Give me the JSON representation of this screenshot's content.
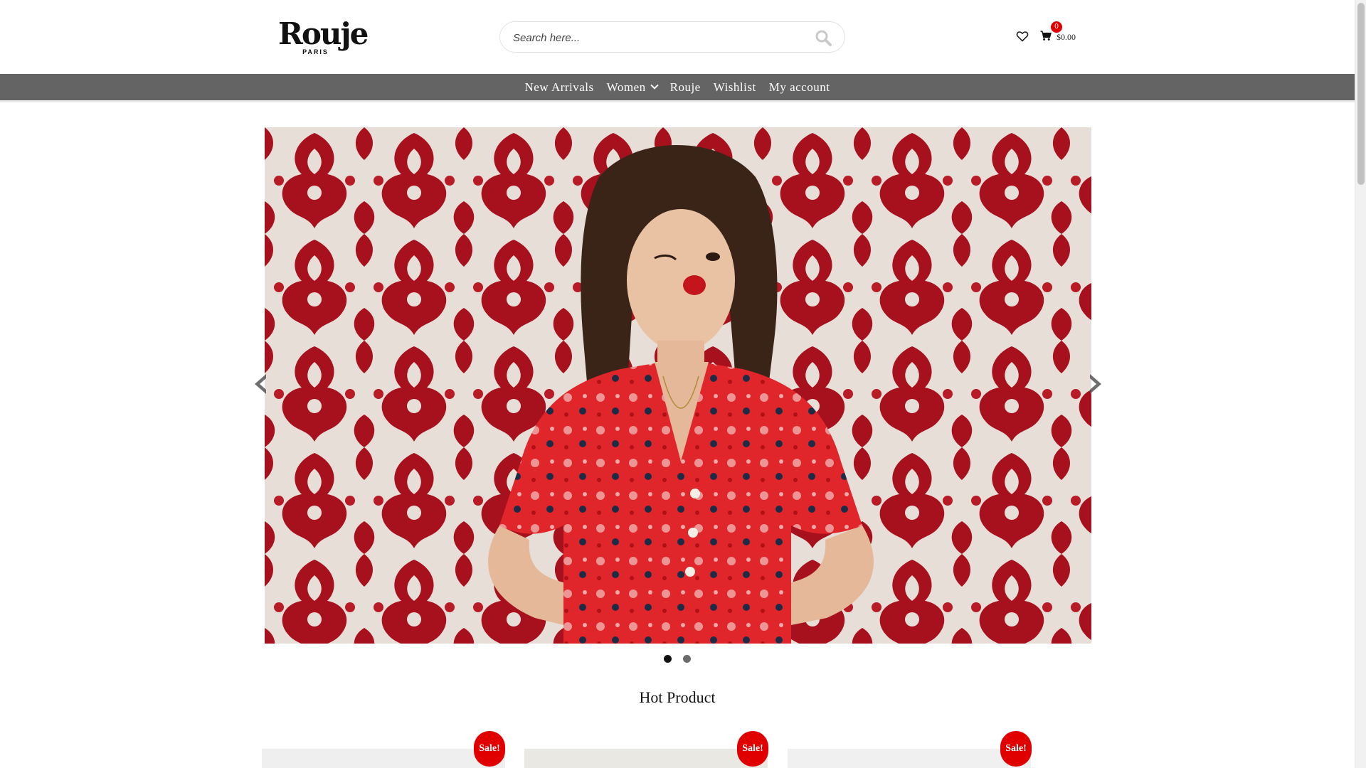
{
  "brand": {
    "logo_main": "Rouje",
    "logo_sub": "PARIS"
  },
  "search": {
    "placeholder": "Search here...",
    "value": ""
  },
  "header": {
    "cart_count": "0",
    "cart_total": "$0.00"
  },
  "nav": {
    "items": [
      {
        "label": "New Arrivals"
      },
      {
        "label": "Women"
      },
      {
        "label": "Rouje"
      },
      {
        "label": "Wishlist"
      },
      {
        "label": "My account"
      }
    ]
  },
  "slider": {
    "slide_count": 2,
    "active_slide": 1
  },
  "hot_product": {
    "title": "Hot Product",
    "products": [
      {
        "badge": "Sale!"
      },
      {
        "badge": "Sale!"
      },
      {
        "badge": "Sale!"
      }
    ]
  },
  "colors": {
    "nav_bg": "#646464",
    "sale_badge": "#e00000",
    "cart_badge": "#e00000",
    "accent_red": "#d81f1f"
  },
  "icons": [
    "search-icon",
    "heart-icon",
    "cart-icon",
    "chevron-down-icon",
    "arrow-left-icon",
    "arrow-right-icon"
  ]
}
